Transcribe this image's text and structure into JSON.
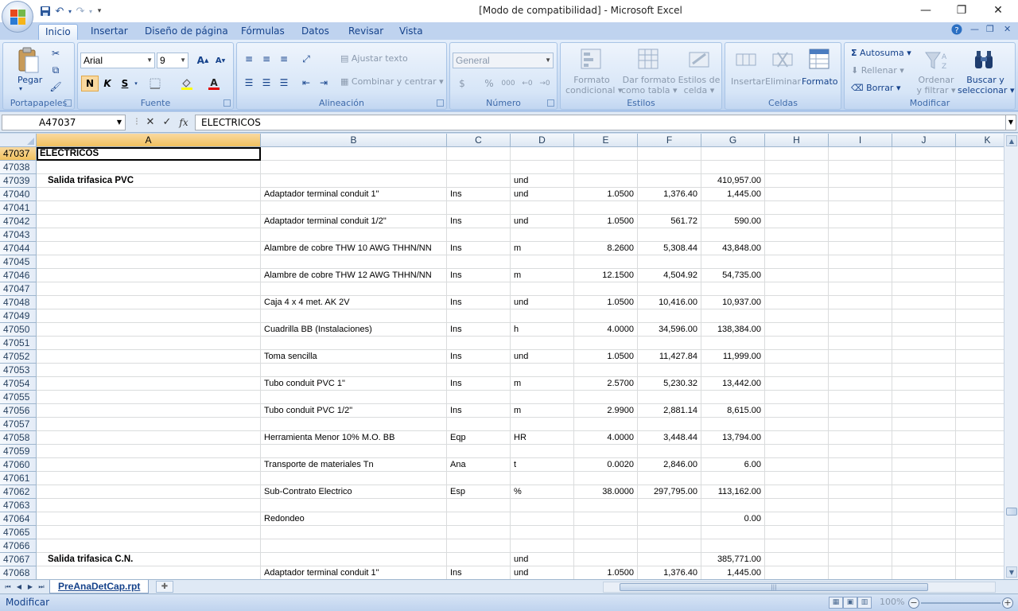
{
  "window": {
    "title": "[Modo de compatibilidad] - Microsoft Excel",
    "minimize": "—",
    "restore": "❐",
    "close": "✕"
  },
  "tabs": [
    "Inicio",
    "Insertar",
    "Diseño de página",
    "Fórmulas",
    "Datos",
    "Revisar",
    "Vista"
  ],
  "ribbon": {
    "portapapeles": {
      "paste": "Pegar",
      "label": "Portapapeles"
    },
    "fuente": {
      "font": "Arial",
      "size": "9",
      "bold": "N",
      "italic": "K",
      "underline": "S",
      "label": "Fuente"
    },
    "alineacion": {
      "wrap": "Ajustar texto",
      "merge": "Combinar y centrar",
      "label": "Alineación"
    },
    "numero": {
      "format": "General",
      "currency": "$",
      "percent": "%",
      "thousands": "000",
      "label": "Número"
    },
    "estilos": {
      "cond_1": "Formato",
      "cond_2": "condicional",
      "table_1": "Dar formato",
      "table_2": "como tabla",
      "cell_1": "Estilos de",
      "cell_2": "celda",
      "label": "Estilos"
    },
    "celdas": {
      "insert": "Insertar",
      "delete": "Eliminar",
      "format": "Formato",
      "label": "Celdas"
    },
    "modificar": {
      "autosum": "Autosuma",
      "fill": "Rellenar",
      "clear": "Borrar",
      "sort_1": "Ordenar",
      "sort_2": "y filtrar",
      "find_1": "Buscar y",
      "find_2": "seleccionar",
      "label": "Modificar"
    }
  },
  "formula_bar": {
    "name_box": "A47037",
    "formula": "ELECTRICOS",
    "fx": "fx"
  },
  "columns": [
    "A",
    "B",
    "C",
    "D",
    "E",
    "F",
    "G",
    "H",
    "I",
    "J",
    "K"
  ],
  "active_column": "A",
  "rows": [
    {
      "n": "47037",
      "A": "ELECTRICOS",
      "B": "",
      "C": "",
      "D": "",
      "E": "",
      "F": "",
      "G": ""
    },
    {
      "n": "47038",
      "A": "",
      "B": "",
      "C": "",
      "D": "",
      "E": "",
      "F": "",
      "G": ""
    },
    {
      "n": "47039",
      "A": "Salida trifasica PVC",
      "B": "",
      "C": "",
      "D": "und",
      "E": "",
      "F": "",
      "G": "410,957.00"
    },
    {
      "n": "47040",
      "A": "",
      "B": "Adaptador terminal conduit  1\"",
      "C": "Ins",
      "D": "und",
      "E": "1.0500",
      "F": "1,376.40",
      "G": "1,445.00"
    },
    {
      "n": "47041",
      "A": "",
      "B": "",
      "C": "",
      "D": "",
      "E": "",
      "F": "",
      "G": ""
    },
    {
      "n": "47042",
      "A": "",
      "B": "Adaptador terminal conduit 1/2\"",
      "C": "Ins",
      "D": "und",
      "E": "1.0500",
      "F": "561.72",
      "G": "590.00"
    },
    {
      "n": "47043",
      "A": "",
      "B": "",
      "C": "",
      "D": "",
      "E": "",
      "F": "",
      "G": ""
    },
    {
      "n": "47044",
      "A": "",
      "B": "Alambre de cobre THW 10 AWG THHN/NN",
      "C": "Ins",
      "D": "m",
      "E": "8.2600",
      "F": "5,308.44",
      "G": "43,848.00"
    },
    {
      "n": "47045",
      "A": "",
      "B": "",
      "C": "",
      "D": "",
      "E": "",
      "F": "",
      "G": ""
    },
    {
      "n": "47046",
      "A": "",
      "B": "Alambre de cobre THW 12 AWG THHN/NN",
      "C": "Ins",
      "D": "m",
      "E": "12.1500",
      "F": "4,504.92",
      "G": "54,735.00"
    },
    {
      "n": "47047",
      "A": "",
      "B": "",
      "C": "",
      "D": "",
      "E": "",
      "F": "",
      "G": ""
    },
    {
      "n": "47048",
      "A": "",
      "B": "Caja  4 x 4 met. AK 2V",
      "C": "Ins",
      "D": "und",
      "E": "1.0500",
      "F": "10,416.00",
      "G": "10,937.00"
    },
    {
      "n": "47049",
      "A": "",
      "B": "",
      "C": "",
      "D": "",
      "E": "",
      "F": "",
      "G": ""
    },
    {
      "n": "47050",
      "A": "",
      "B": "Cuadrilla BB  (Instalaciones)",
      "C": "Ins",
      "D": "h",
      "E": "4.0000",
      "F": "34,596.00",
      "G": "138,384.00"
    },
    {
      "n": "47051",
      "A": "",
      "B": "",
      "C": "",
      "D": "",
      "E": "",
      "F": "",
      "G": ""
    },
    {
      "n": "47052",
      "A": "",
      "B": "Toma sencilla",
      "C": "Ins",
      "D": "und",
      "E": "1.0500",
      "F": "11,427.84",
      "G": "11,999.00"
    },
    {
      "n": "47053",
      "A": "",
      "B": "",
      "C": "",
      "D": "",
      "E": "",
      "F": "",
      "G": ""
    },
    {
      "n": "47054",
      "A": "",
      "B": "Tubo conduit PVC 1\"",
      "C": "Ins",
      "D": "m",
      "E": "2.5700",
      "F": "5,230.32",
      "G": "13,442.00"
    },
    {
      "n": "47055",
      "A": "",
      "B": "",
      "C": "",
      "D": "",
      "E": "",
      "F": "",
      "G": ""
    },
    {
      "n": "47056",
      "A": "",
      "B": "Tubo conduit PVC 1/2\"",
      "C": "Ins",
      "D": "m",
      "E": "2.9900",
      "F": "2,881.14",
      "G": "8,615.00"
    },
    {
      "n": "47057",
      "A": "",
      "B": "",
      "C": "",
      "D": "",
      "E": "",
      "F": "",
      "G": ""
    },
    {
      "n": "47058",
      "A": "",
      "B": "Herramienta Menor 10% M.O. BB",
      "C": "Eqp",
      "D": "HR",
      "E": "4.0000",
      "F": "3,448.44",
      "G": "13,794.00"
    },
    {
      "n": "47059",
      "A": "",
      "B": "",
      "C": "",
      "D": "",
      "E": "",
      "F": "",
      "G": ""
    },
    {
      "n": "47060",
      "A": "",
      "B": "Transporte de materiales Tn",
      "C": "Ana",
      "D": "t",
      "E": "0.0020",
      "F": "2,846.00",
      "G": "6.00"
    },
    {
      "n": "47061",
      "A": "",
      "B": "",
      "C": "",
      "D": "",
      "E": "",
      "F": "",
      "G": ""
    },
    {
      "n": "47062",
      "A": "",
      "B": "Sub-Contrato Electrico",
      "C": "Esp",
      "D": "%",
      "E": "38.0000",
      "F": "297,795.00",
      "G": "113,162.00"
    },
    {
      "n": "47063",
      "A": "",
      "B": "",
      "C": "",
      "D": "",
      "E": "",
      "F": "",
      "G": ""
    },
    {
      "n": "47064",
      "A": "",
      "B": "Redondeo",
      "C": "",
      "D": "",
      "E": "",
      "F": "",
      "G": "0.00"
    },
    {
      "n": "47065",
      "A": "",
      "B": "",
      "C": "",
      "D": "",
      "E": "",
      "F": "",
      "G": ""
    },
    {
      "n": "47066",
      "A": "",
      "B": "",
      "C": "",
      "D": "",
      "E": "",
      "F": "",
      "G": ""
    },
    {
      "n": "47067",
      "A": "Salida trifasica C.N.",
      "B": "",
      "C": "",
      "D": "und",
      "E": "",
      "F": "",
      "G": "385,771.00"
    },
    {
      "n": "47068",
      "A": "",
      "B": "Adaptador terminal conduit  1\"",
      "C": "Ins",
      "D": "und",
      "E": "1.0500",
      "F": "1,376.40",
      "G": "1,445.00"
    }
  ],
  "sheet_tab": "PreAnaDetCap.rpt",
  "status": {
    "mode": "Modificar",
    "zoom": "100%"
  }
}
